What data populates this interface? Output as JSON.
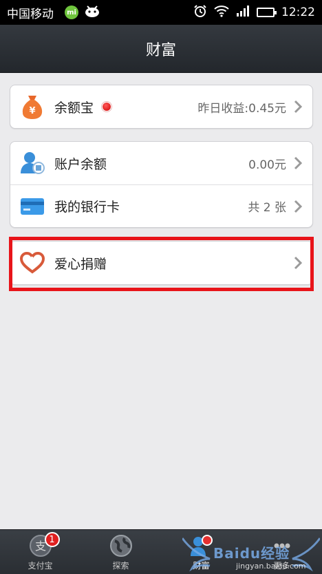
{
  "status_bar": {
    "carrier": "中国移动",
    "mi_badge": "mi",
    "time": "12:22"
  },
  "header": {
    "title": "财富"
  },
  "cards": {
    "yuebao": {
      "label": "余额宝",
      "value": "昨日收益:0.45元"
    },
    "balance": {
      "label": "账户余额",
      "value": "0.00元"
    },
    "bankcard": {
      "label": "我的银行卡",
      "value": "共 2 张"
    },
    "donate": {
      "label": "爱心捐赠"
    }
  },
  "tabs": [
    {
      "label": "支付宝",
      "badge": "1"
    },
    {
      "label": "探索"
    },
    {
      "label": "财富"
    },
    {
      "label": "更多"
    }
  ],
  "watermark": {
    "main": "Baidu经验",
    "sub": "jingyan.baidu.com"
  },
  "colors": {
    "accent_red": "#e8141a",
    "header_bg": "#2c3036",
    "page_bg": "#ebebed"
  }
}
